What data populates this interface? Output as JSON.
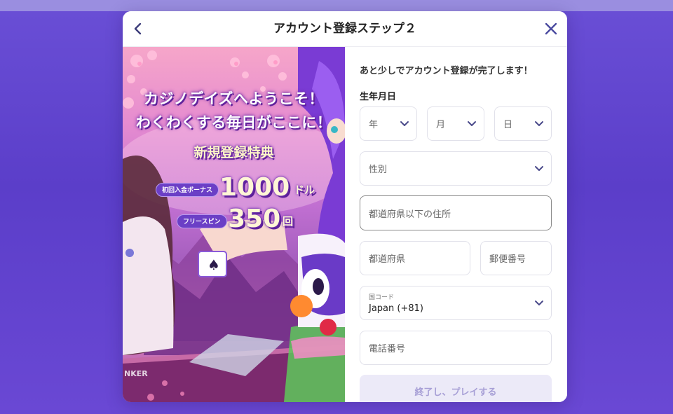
{
  "modal": {
    "title": "アカウント登録ステップ２",
    "back_icon": "chevron-left-icon",
    "close_icon": "close-icon"
  },
  "promo": {
    "line1": "カジノデイズへようこそ！",
    "line2": "わくわくする毎日がここに！",
    "benefit_title": "新規登録特典",
    "first_deposit_label": "初回入金ボーナス",
    "first_deposit_amount": "1000",
    "first_deposit_unit": "ドル",
    "free_spin_label": "フリースピン",
    "free_spin_amount": "350",
    "free_spin_unit": "回"
  },
  "form": {
    "subtitle": "あと少しでアカウント登録が完了します！",
    "dob_label": "生年月日",
    "year_placeholder": "年",
    "month_placeholder": "月",
    "day_placeholder": "日",
    "gender_placeholder": "性別",
    "address_placeholder": "都道府県以下の住所",
    "prefecture_placeholder": "都道府県",
    "zip_placeholder": "郵便番号",
    "country_code_label": "国コード",
    "country_code_value": "Japan (+81)",
    "phone_placeholder": "電話番号",
    "submit_label": "終了し、プレイする"
  },
  "colors": {
    "background": "#5b3ec9",
    "accent": "#6b3fc6",
    "submit_bg": "#eceaf8",
    "submit_text": "#a79fd6"
  }
}
